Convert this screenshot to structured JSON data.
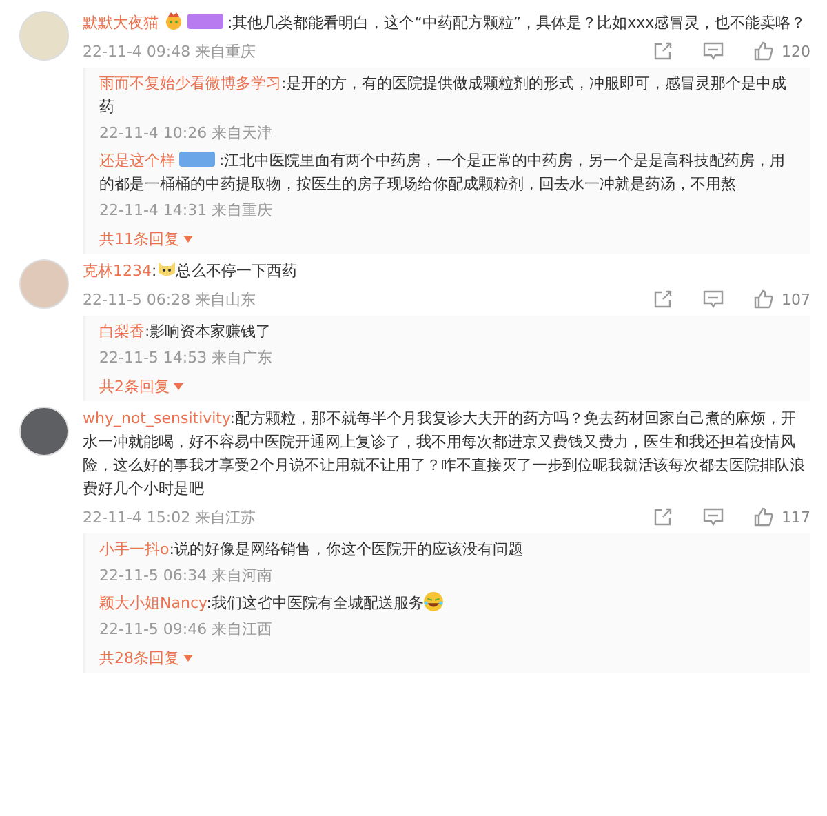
{
  "comments": [
    {
      "user": "默默大夜猫",
      "name_icons": [
        {
          "kind": "crown-emoji"
        },
        {
          "kind": "level-badge"
        }
      ],
      "parts": [
        {
          "kind": "text",
          "value": ":其他几类都能看明白，这个“中药配方颗粒”，具体是？比如xxx感冒灵，也不能卖咯？"
        }
      ],
      "time": "22-11-4 09:48",
      "location": "来自重庆",
      "likes": "120",
      "replies": [
        {
          "user": "雨而不复始少看微博多学习",
          "parts": [
            {
              "kind": "text",
              "value": ":是开的方，有的医院提供做成颗粒剂的形式，冲服即可，感冒灵那个是中成药"
            }
          ],
          "time": "22-11-4 10:26",
          "location": "来自天津"
        },
        {
          "user": "还是这个样",
          "name_icons": [
            {
              "kind": "fan-badge"
            }
          ],
          "parts": [
            {
              "kind": "text",
              "value": ":江北中医院里面有两个中药房，一个是正常的中药房，另一个是是高科技配药房，用的都是一桶桶的中药提取物，按医生的房子现场给你配成颗粒剂，回去水一冲就是药汤，不用熬"
            }
          ],
          "time": "22-11-4 14:31",
          "location": "来自重庆"
        }
      ],
      "more": "共11条回复"
    },
    {
      "user": "克林1234",
      "parts": [
        {
          "kind": "text",
          "value": ":"
        },
        {
          "kind": "cat-emoji"
        },
        {
          "kind": "text",
          "value": "总么不停一下西药"
        }
      ],
      "time": "22-11-5 06:28",
      "location": "来自山东",
      "likes": "107",
      "replies": [
        {
          "user": "白梨香",
          "parts": [
            {
              "kind": "text",
              "value": ":影响资本家赚钱了"
            }
          ],
          "time": "22-11-5 14:53",
          "location": "来自广东"
        }
      ],
      "more": "共2条回复"
    },
    {
      "user": "why_not_sensitivity",
      "parts": [
        {
          "kind": "text",
          "value": ":配方颗粒，那不就每半个月我复诊大夫开的药方吗？免去药材回家自己煮的麻烦，开水一冲就能喝，好不容易中医院开通网上复诊了，我不用每次都进京又费钱又费力，医生和我还担着疫情风险，这么好的事我才享受2个月说不让用就不让用了？咋不直接灭了一步到位呢我就活该每次都去医院排队浪费好几个小时是吧"
        }
      ],
      "time": "22-11-4 15:02",
      "location": "来自江苏",
      "likes": "117",
      "replies": [
        {
          "user": "小手一抖o",
          "parts": [
            {
              "kind": "text",
              "value": ":说的好像是网络销售，你这个医院开的应该没有问题"
            }
          ],
          "time": "22-11-5 06:34",
          "location": "来自河南"
        },
        {
          "user": "颖大小姐Nancy",
          "parts": [
            {
              "kind": "text",
              "value": ":我们这省中医院有全城配送服务"
            },
            {
              "kind": "laugh-emoji"
            }
          ],
          "time": "22-11-5 09:46",
          "location": "来自江西"
        }
      ],
      "more": "共28条回复"
    }
  ]
}
